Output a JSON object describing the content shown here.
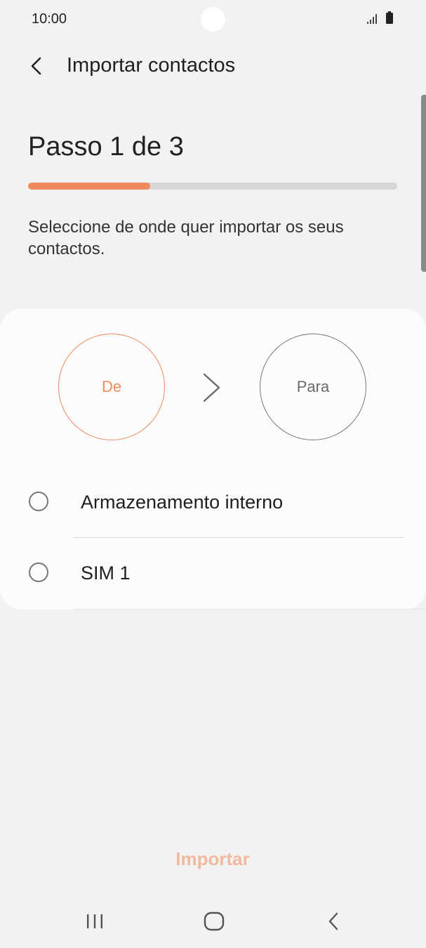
{
  "status_bar": {
    "time": "10:00",
    "icons": [
      "signal-icon",
      "battery-icon"
    ]
  },
  "header": {
    "title": "Importar contactos",
    "back_icon": "chevron-left-icon"
  },
  "step": {
    "title": "Passo 1 de 3",
    "progress_fraction": 0.33
  },
  "instruction": "Seleccione de onde quer importar os seus contactos.",
  "transfer": {
    "from_label": "De",
    "to_label": "Para",
    "arrow_icon": "chevron-right-icon"
  },
  "options": [
    {
      "label": "Armazenamento interno",
      "selected": false
    },
    {
      "label": "SIM 1",
      "selected": false
    }
  ],
  "import_button": {
    "label": "Importar",
    "enabled": false
  },
  "colors": {
    "accent": "#ef8a5d",
    "accent_disabled": "#f0b9a0",
    "background": "#f2f2f2",
    "card": "#fcfcfc"
  },
  "nav_bar": {
    "icons": [
      "recents-icon",
      "home-icon",
      "back-icon"
    ]
  }
}
